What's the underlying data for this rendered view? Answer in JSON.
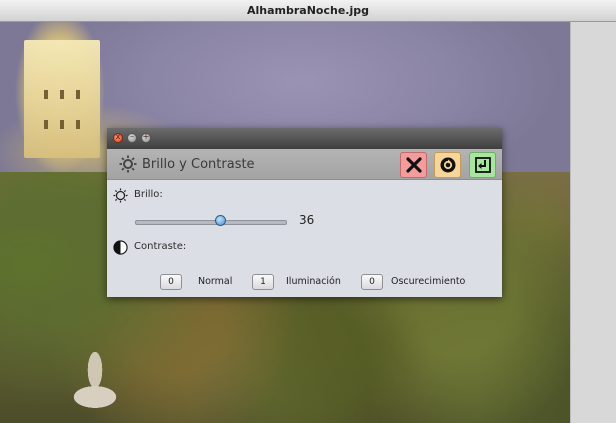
{
  "window": {
    "title": "AlhambraNoche.jpg"
  },
  "dialog": {
    "title": "Brillo y Contraste",
    "window_controls": {
      "close_glyph": "x",
      "min_glyph": "–",
      "max_glyph": "+"
    },
    "actions": [
      {
        "name": "cancel",
        "icon": "x-icon",
        "color": "#f39c9c"
      },
      {
        "name": "reset",
        "icon": "reset-icon",
        "color": "#f6d49a"
      },
      {
        "name": "apply",
        "icon": "apply-icon",
        "color": "#a8e6a0"
      }
    ],
    "brightness": {
      "label": "Brillo:",
      "value": "36",
      "slider_fraction": 0.56
    },
    "contrast": {
      "label": "Contraste:",
      "options": [
        {
          "value": "0",
          "label": "Normal"
        },
        {
          "value": "1",
          "label": "Iluminación"
        },
        {
          "value": "0",
          "label": "Oscurecimiento"
        }
      ]
    }
  }
}
